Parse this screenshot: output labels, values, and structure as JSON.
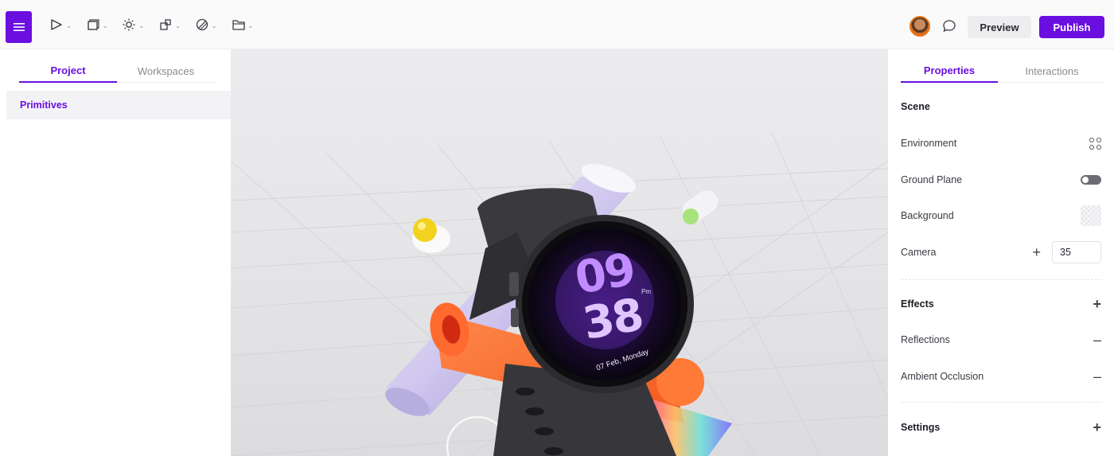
{
  "toolbar": {
    "menu_icon": "hamburger-icon",
    "tools": [
      {
        "icon": "cursor-icon"
      },
      {
        "icon": "frame-icon"
      },
      {
        "icon": "sun-icon"
      },
      {
        "icon": "shapes-icon"
      },
      {
        "icon": "material-icon"
      },
      {
        "icon": "folder-icon"
      }
    ],
    "comment_icon": "comment-icon",
    "preview_label": "Preview",
    "publish_label": "Publish",
    "accent_color": "#6a0fe0"
  },
  "left_panel": {
    "tabs": [
      {
        "label": "Project",
        "active": true
      },
      {
        "label": "Workspaces",
        "active": false
      }
    ],
    "items": [
      {
        "label": "Primitives",
        "selected": true
      }
    ]
  },
  "viewport": {
    "watch": {
      "hour": "09",
      "minute": "38",
      "ampm": "Pm",
      "date": "07 Feb, Monday"
    }
  },
  "right_panel": {
    "tabs": [
      {
        "label": "Properties",
        "active": true
      },
      {
        "label": "Interactions",
        "active": false
      }
    ],
    "scene": {
      "heading": "Scene",
      "environment_label": "Environment",
      "ground_plane_label": "Ground Plane",
      "background_label": "Background",
      "camera_label": "Camera",
      "camera_value": "35"
    },
    "effects": {
      "heading": "Effects",
      "reflections_label": "Reflections",
      "ambient_occlusion_label": "Ambient Occlusion"
    },
    "settings": {
      "heading": "Settings"
    }
  }
}
